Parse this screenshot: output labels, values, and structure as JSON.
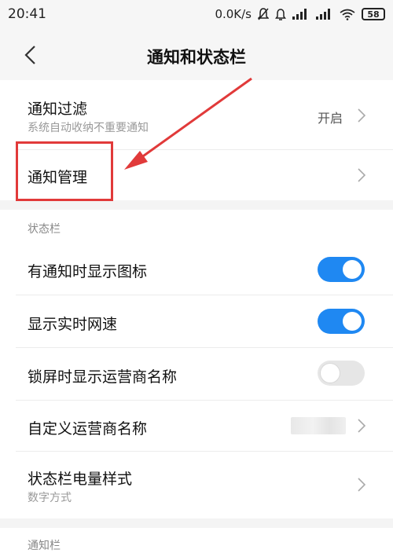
{
  "status_bar": {
    "time": "20:41",
    "net_speed": "0.0K/s",
    "battery": "58"
  },
  "header": {
    "title": "通知和状态栏"
  },
  "items": {
    "notification_filter": {
      "title": "通知过滤",
      "subtitle": "系统自动收纳不重要通知",
      "value": "开启"
    },
    "notification_manage": {
      "title": "通知管理"
    },
    "show_icons": {
      "title": "有通知时显示图标",
      "enabled": true
    },
    "show_speed": {
      "title": "显示实时网速",
      "enabled": true
    },
    "lockscreen_carrier": {
      "title": "锁屏时显示运营商名称",
      "enabled": false
    },
    "custom_carrier": {
      "title": "自定义运营商名称"
    },
    "battery_style": {
      "title": "状态栏电量样式",
      "subtitle": "数字方式"
    }
  },
  "sections": {
    "status_bar_label": "状态栏",
    "notification_bar_label": "通知栏"
  },
  "colors": {
    "accent": "#1f88f2",
    "annotation": "#e13a3a"
  }
}
